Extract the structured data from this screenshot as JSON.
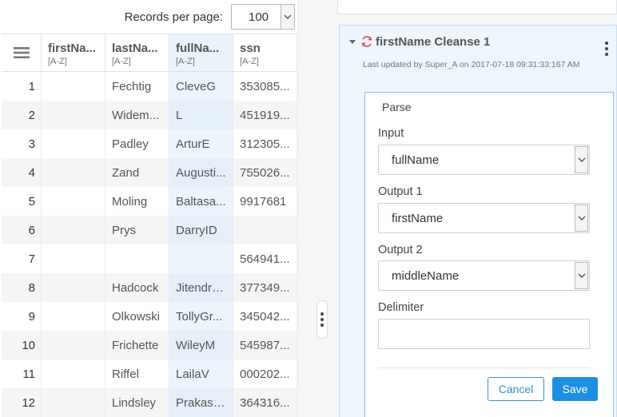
{
  "pagination": {
    "label": "Records per page:",
    "value": "100"
  },
  "grid": {
    "columns": [
      {
        "name": "firstNa...",
        "sort": "[A-Z]"
      },
      {
        "name": "lastNa...",
        "sort": "[A-Z]"
      },
      {
        "name": "fullNa...",
        "sort": "[A-Z]"
      },
      {
        "name": "ssn",
        "sort": "[A-Z]"
      }
    ],
    "rows": [
      {
        "n": "1",
        "first": "",
        "last": "Fechtig",
        "full": "CleveG",
        "ssn": "353085..."
      },
      {
        "n": "2",
        "first": "",
        "last": "Widem...",
        "full": "L",
        "ssn": "451919..."
      },
      {
        "n": "3",
        "first": "",
        "last": "Padley",
        "full": "ArturE",
        "ssn": "312305..."
      },
      {
        "n": "4",
        "first": "",
        "last": "Zand",
        "full": "Augusti...",
        "ssn": "755026..."
      },
      {
        "n": "5",
        "first": "",
        "last": "Moling",
        "full": "Baltasa...",
        "ssn": "9917681"
      },
      {
        "n": "6",
        "first": "",
        "last": "Prys",
        "full": "DarryID",
        "ssn": ""
      },
      {
        "n": "7",
        "first": "",
        "last": "",
        "full": "",
        "ssn": "564941..."
      },
      {
        "n": "8",
        "first": "",
        "last": "Hadcock",
        "full": "JitendraD",
        "ssn": "377349..."
      },
      {
        "n": "9",
        "first": "",
        "last": "Olkowski",
        "full": "TollyGr...",
        "ssn": "345042..."
      },
      {
        "n": "10",
        "first": "",
        "last": "Frichette",
        "full": "WileyM",
        "ssn": "545987..."
      },
      {
        "n": "11",
        "first": "",
        "last": "Riffel",
        "full": "LailaV",
        "ssn": "000202..."
      },
      {
        "n": "12",
        "first": "",
        "last": "Lindsley",
        "full": "PrakashE",
        "ssn": "364316..."
      }
    ]
  },
  "card": {
    "title": "firstName Cleanse 1",
    "meta_prefix": "Last updated by ",
    "meta_user": "Super_A",
    "meta_on": " on ",
    "meta_date": "2017-07-18 09:31:33:167 AM",
    "form": {
      "title": "Parse",
      "input_label": "Input",
      "input_value": "fullName",
      "output1_label": "Output 1",
      "output1_value": "firstName",
      "output2_label": "Output 2",
      "output2_value": "middleName",
      "delimiter_label": "Delimiter",
      "delimiter_value": "",
      "cancel_label": "Cancel",
      "save_label": "Save"
    }
  },
  "colors": {
    "accent": "#1e8fe0",
    "refresh_icon": "#e0413a",
    "selected_column": "#eaf3fb",
    "card_background": "#eef5fb"
  },
  "icons": {
    "grid_menu": "hamburger-icon",
    "refresh": "refresh-icon",
    "more": "kebab-icon",
    "dropdown": "chevron-down-icon",
    "collapse": "caret-down-icon",
    "splitter": "drag-handle-icon"
  }
}
